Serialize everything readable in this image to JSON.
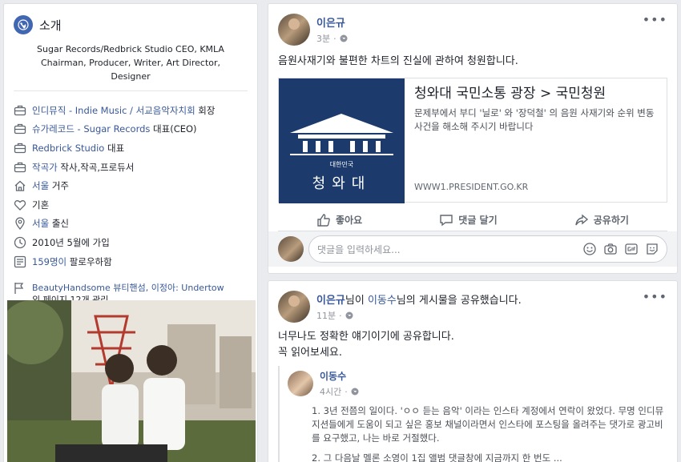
{
  "intro": {
    "title": "소개",
    "bio": "Sugar Records/Redbrick Studio CEO, KMLA Chairman, Producer, Writer, Art Director, Designer",
    "items": [
      {
        "icon": "briefcase-icon",
        "link": "인디뮤직 - Indie Music / 서교음악자치회",
        "suffix": " 회장"
      },
      {
        "icon": "briefcase-icon",
        "link": "슈가레코드 - Sugar Records",
        "suffix": " 대표(CEO)"
      },
      {
        "icon": "briefcase-icon",
        "link": "Redbrick Studio",
        "suffix": " 대표"
      },
      {
        "icon": "briefcase-icon",
        "link": "작곡가",
        "suffix": " 작사,작곡,프로듀서"
      },
      {
        "icon": "home-icon",
        "link": "서울",
        "suffix": " 거주"
      },
      {
        "icon": "heart-icon",
        "link": "",
        "suffix": "기혼"
      },
      {
        "icon": "location-pin-icon",
        "link": "서울",
        "suffix": " 출신"
      },
      {
        "icon": "clock-icon",
        "link": "",
        "suffix": "2010년 5월에 가입"
      },
      {
        "icon": "feed-icon",
        "link": "159명이",
        "suffix": " 팔로우하함"
      }
    ],
    "manage_link": "BeautyHandsome 뷰티핸섬, 이정아: Undertow",
    "manage_suffix": "외 페이지 12개 관리"
  },
  "post1": {
    "author": "이은규",
    "time": "3분",
    "text": "음원사재기와 불편한 차트의 진실에 관하여 청원합니다.",
    "link": {
      "title": "청와대 국민소통 광장 > 국민청원",
      "desc": "문제부에서 부디 '닐로' 와 '장덕철' 의 음원 사재기와 순위 변동 사건을 해소해 주시기 바랍니다",
      "url": "WWW1.PRESIDENT.GO.KR",
      "img_small": "대한민국",
      "img_big": "청와대"
    },
    "actions": {
      "like": "좋아요",
      "comment": "댓글 달기",
      "share": "공유하기"
    },
    "comment_placeholder": "댓글을 입력하세요..."
  },
  "post2": {
    "author": "이은규",
    "shared_mid": "님이 ",
    "shared_user": "이동수",
    "shared_suffix": "님의 게시물을 공유했습니다.",
    "time": "11분",
    "text1": "너무나도 정확한 얘기이기에 공유합니다.",
    "text2": "꼭 읽어보세요.",
    "quote_author": "이동수",
    "quote_time": "4시간",
    "quote_p1": "1. 3년 전쯤의 일이다. 'ㅇㅇ 듣는 음악' 이라는 인스타 계정에서 연락이 왔었다. 무명 인디뮤지션들에게 도움이 되고 싶은 홍보 채널이라면서 인스타에 포스팅을 올려주는 댓가로 광고비를 요구했고, 나는 바로 거절했다.",
    "quote_p2": "2. 그 다음날 멜론 소영이 1집 앨범 댓글창에 지금까지 한 번도 ..."
  }
}
